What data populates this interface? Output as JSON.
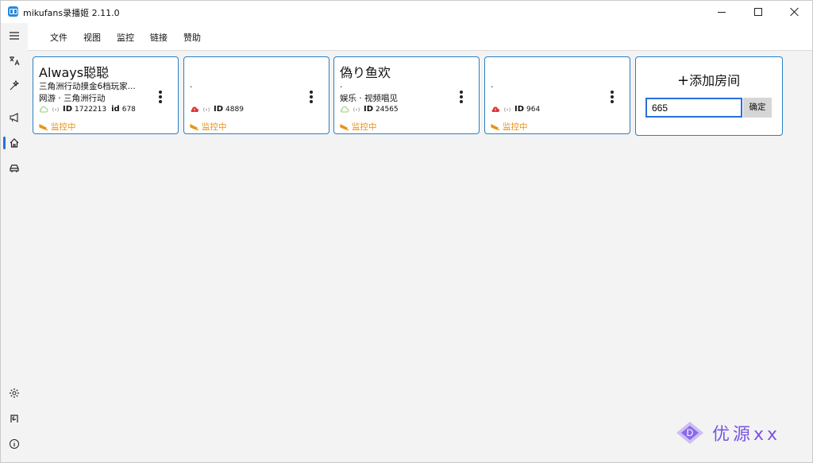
{
  "window": {
    "title": "mikufans录播姬 2.11.0"
  },
  "menu": {
    "file": "文件",
    "view": "视图",
    "monitor": "监控",
    "links": "链接",
    "sponsor": "赞助"
  },
  "cards": [
    {
      "title": "Always聪聪",
      "subtitle": "三角洲行动摸金6档玩家...",
      "area": "网游 · 三角洲行动",
      "cloud_status": "ok",
      "id_label": "ID",
      "id_value": "1722213",
      "short_id_label": "id",
      "short_id_value": "678",
      "monitor_label": "监控中"
    },
    {
      "title": "",
      "subtitle": ".",
      "area": "",
      "cloud_status": "error",
      "id_label": "ID",
      "id_value": "4889",
      "short_id_label": "",
      "short_id_value": "",
      "monitor_label": "监控中"
    },
    {
      "title": "偽り鱼欢",
      "subtitle": ".",
      "area": "娱乐 · 视频唱见",
      "cloud_status": "ok",
      "id_label": "ID",
      "id_value": "24565",
      "short_id_label": "",
      "short_id_value": "",
      "monitor_label": "监控中"
    },
    {
      "title": "",
      "subtitle": ".",
      "area": "",
      "cloud_status": "error",
      "id_label": "ID",
      "id_value": "964",
      "short_id_label": "",
      "short_id_value": "",
      "monitor_label": "监控中"
    }
  ],
  "add_room": {
    "title": "添加房间",
    "input_value": "665",
    "confirm": "确定"
  },
  "watermark": {
    "text": "优源xx"
  },
  "colors": {
    "accent": "#2a6fdb",
    "card_border": "#2a7fc4",
    "monitor": "#e89319",
    "cloud_ok": "#8bd06a",
    "cloud_error": "#e03131"
  }
}
